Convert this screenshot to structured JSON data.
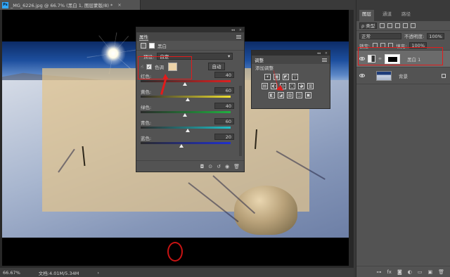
{
  "document": {
    "tab_title": "_MG_6226.jpg @ 66.7% (黑白 1, 图层蒙版/8) *",
    "ps_badge": "Ps",
    "close_glyph": "×"
  },
  "status_bar": {
    "zoom": "66.67%",
    "doc_info": "文档:4.01M/5.34M",
    "arrow": "›"
  },
  "properties_panel": {
    "collapse_glyph": "◂◂",
    "close_glyph": "×",
    "tab_label": "属性",
    "title": "黑白",
    "preset_label": "预设:",
    "preset_value": "自定",
    "tint_label": "色调",
    "tint_color": "#ecd3a8",
    "auto_button": "自动",
    "sliders": [
      {
        "label": "红色:",
        "value": "40",
        "fraction": 0.49,
        "gradient": "linear-gradient(90deg,#2a2a2a,#e02020)"
      },
      {
        "label": "黄色:",
        "value": "60",
        "fraction": 0.52,
        "gradient": "linear-gradient(90deg,#2a2a2a,#f0e030)"
      },
      {
        "label": "绿色:",
        "value": "40",
        "fraction": 0.49,
        "gradient": "linear-gradient(90deg,#2a2a2a,#20b040)"
      },
      {
        "label": "青色:",
        "value": "60",
        "fraction": 0.52,
        "gradient": "linear-gradient(90deg,#2a2a2a,#20c0c8)"
      },
      {
        "label": "蓝色:",
        "value": "20",
        "fraction": 0.45,
        "gradient": "linear-gradient(90deg,#2a2a2a,#2030d0)"
      }
    ],
    "footer_icons": [
      "◘",
      "⊙",
      "↺",
      "◉",
      "🗑"
    ]
  },
  "adjustments_panel": {
    "collapse_glyph": "◂◂",
    "close_glyph": "×",
    "tab_label": "调整",
    "hint": "添加调整",
    "row1": [
      "☀",
      "▦",
      "◩",
      "▽"
    ],
    "row2": [
      "▤",
      "◐",
      "◎",
      "▢",
      "◕",
      "▥"
    ],
    "row3": [
      "◧",
      "◪",
      "▧",
      "◫",
      "▣"
    ]
  },
  "layers_panel": {
    "tabs": [
      "图层",
      "通道",
      "路径"
    ],
    "filter_label": "ρ 类型",
    "blend_mode": "正常",
    "opacity_label": "不透明度:",
    "opacity_value": "100%",
    "lock_label": "锁定:",
    "fill_label": "填充:",
    "fill_value": "100%",
    "layers": [
      {
        "name": "黑白 1",
        "type": "adjustment",
        "selected": true
      },
      {
        "name": "背景",
        "type": "background",
        "selected": false
      }
    ],
    "footer_icons": [
      "⊶",
      "fx",
      "◙",
      "◐",
      "▭",
      "▣",
      "🗑"
    ]
  },
  "accent_colors": {
    "annotation_red": "#e21b1b",
    "ps_blue": "#31a8ff",
    "tint_swatch": "#ecd3a8"
  }
}
